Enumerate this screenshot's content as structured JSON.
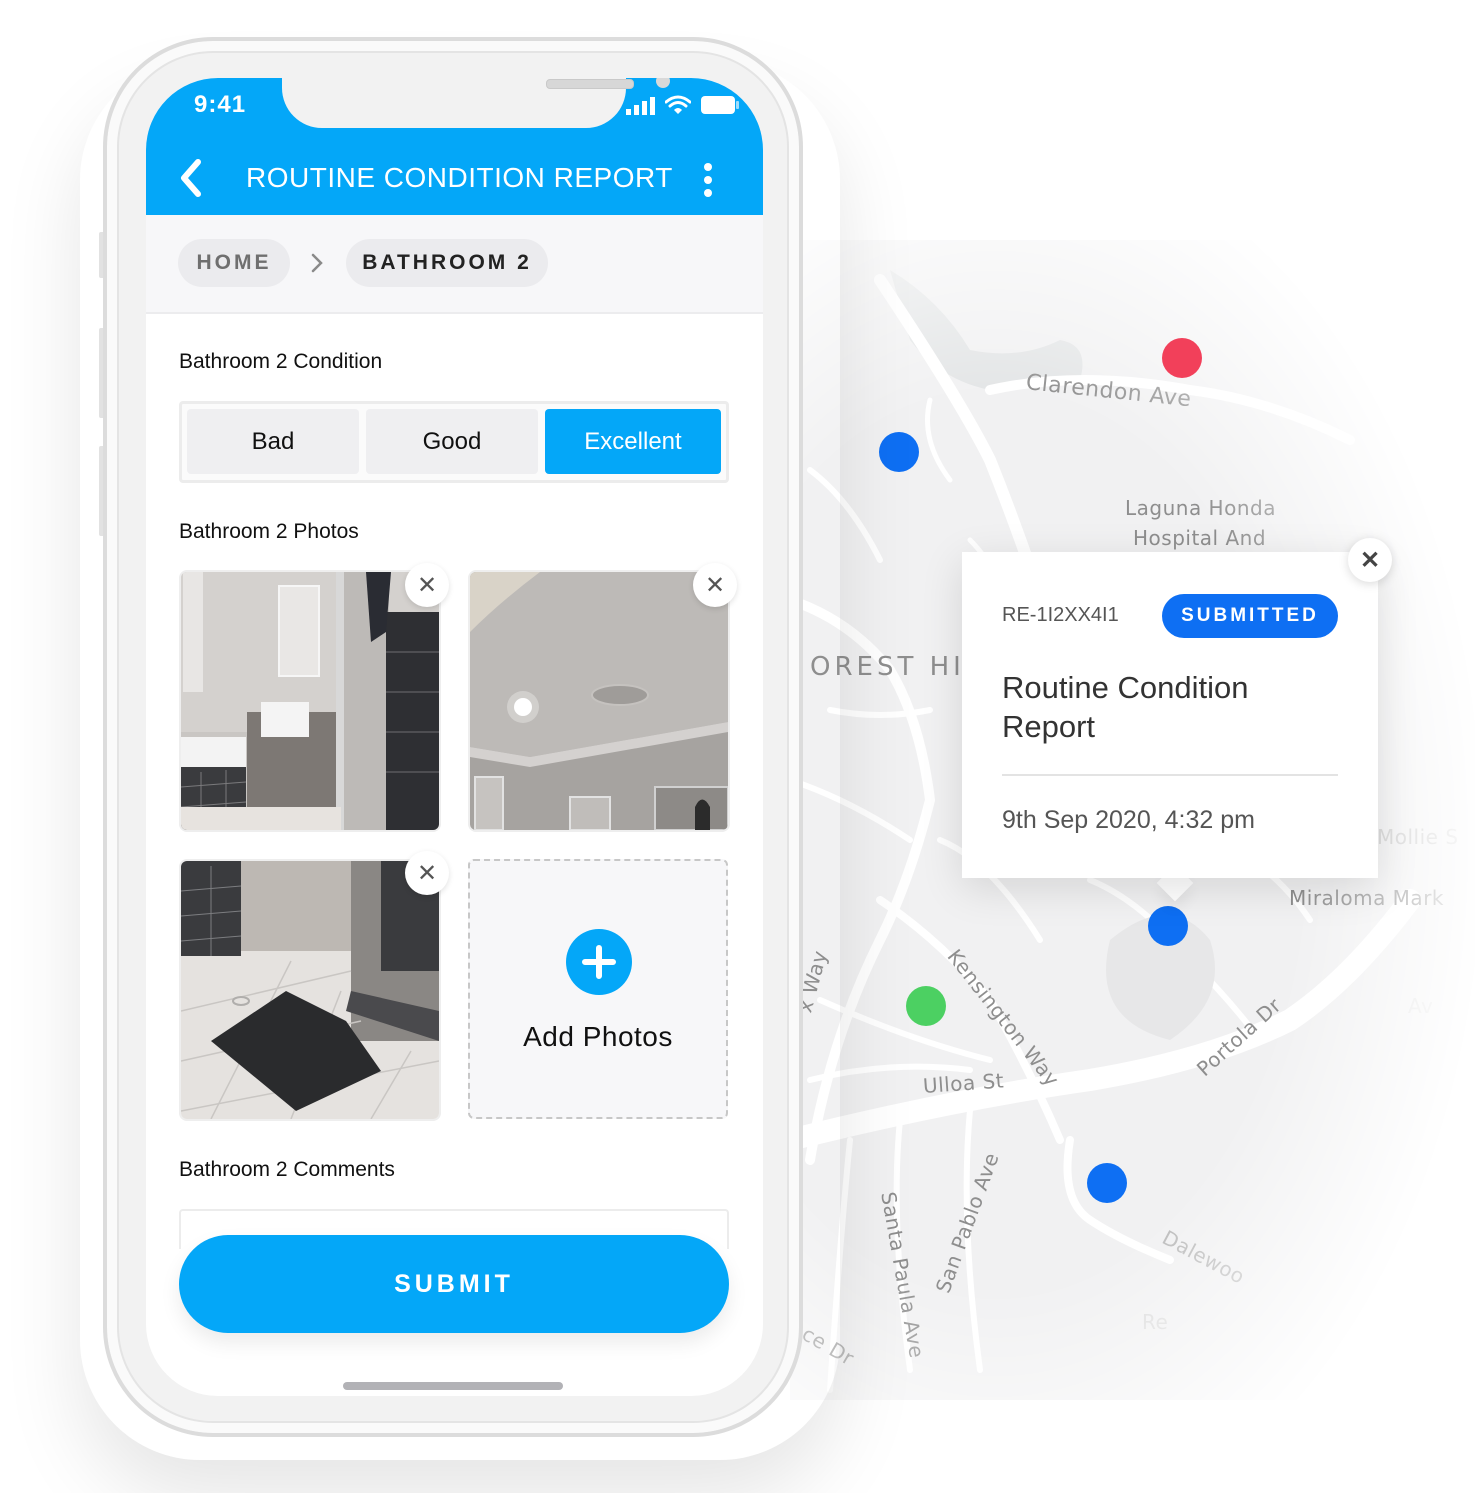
{
  "phone": {
    "status_bar": {
      "time": "9:41",
      "icons": [
        "cellular-signal-icon",
        "wifi-icon",
        "battery-icon"
      ]
    },
    "header": {
      "title": "ROUTINE CONDITION REPORT",
      "back_icon": "chevron-left-icon",
      "menu_icon": "more-vertical-icon"
    },
    "breadcrumb": {
      "items": [
        {
          "label": "HOME"
        },
        {
          "label": "BATHROOM 2"
        }
      ],
      "separator_icon": "chevron-right-icon"
    },
    "condition": {
      "label": "Bathroom 2 Condition",
      "options": [
        {
          "label": "Bad"
        },
        {
          "label": "Good"
        },
        {
          "label": "Excellent"
        }
      ],
      "selected": "Excellent"
    },
    "photos": {
      "label": "Bathroom 2 Photos",
      "items": [
        {
          "description": "bathroom vanity and shower"
        },
        {
          "description": "bathroom ceiling with light and fan"
        },
        {
          "description": "bathroom floor with mat"
        }
      ],
      "remove_icon": "close-icon",
      "add_label": "Add Photos",
      "add_icon": "plus-icon"
    },
    "comments": {
      "label": "Bathroom 2 Comments",
      "value": "",
      "placeholder": ""
    },
    "submit_label": "SUBMIT"
  },
  "map": {
    "labels": [
      "Clarendon Ave",
      "Laguna Honda",
      "Hospital And",
      "OREST HIL",
      "Mollie S",
      "Miraloma Mark",
      "Kensington Way",
      "Portola Dr",
      "Ulloa St",
      "x Way",
      "San Pablo Ave",
      "Santa Paula Ave",
      "ce Dr",
      "Dalewoo",
      "Re",
      "Av"
    ],
    "pins": [
      {
        "color": "#f2405a",
        "status": "red"
      },
      {
        "color": "#0e6ff3",
        "status": "blue"
      },
      {
        "color": "#0e6ff3",
        "status": "blue"
      },
      {
        "color": "#4cd062",
        "status": "green"
      },
      {
        "color": "#0e6ff3",
        "status": "blue"
      }
    ]
  },
  "popup": {
    "id": "RE-1I2XX4I1",
    "status": "SUBMITTED",
    "title": "Routine Condition Report",
    "date": "9th Sep 2020, 4:32 pm",
    "close_icon": "close-icon"
  },
  "colors": {
    "primary": "#04a7f8",
    "badge": "#0e6ff3"
  }
}
